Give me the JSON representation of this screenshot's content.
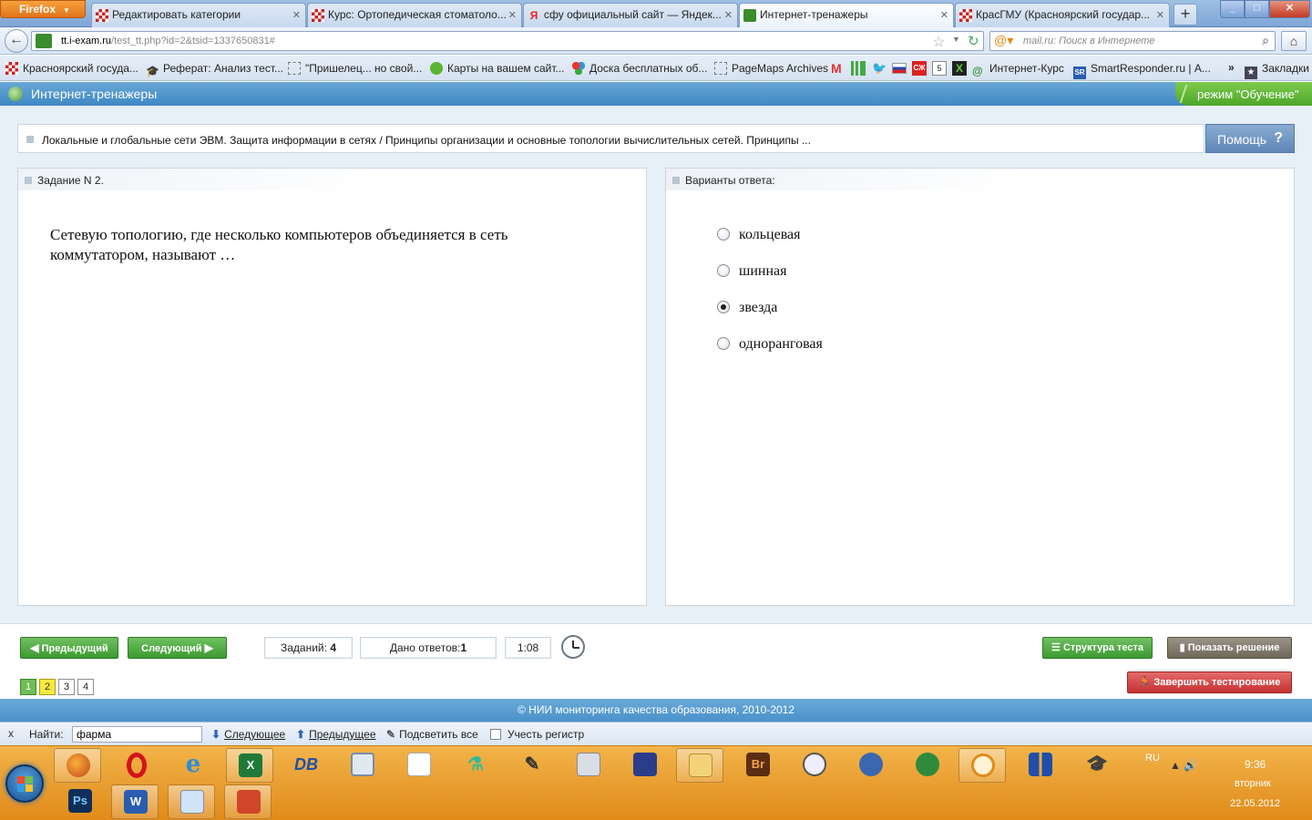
{
  "browser": {
    "menu_label": "Firefox",
    "tabs": [
      {
        "title": "Редактировать категории"
      },
      {
        "title": "Курс: Ортопедическая стоматоло..."
      },
      {
        "title": "сфу официальный сайт — Яндек..."
      },
      {
        "title": "Интернет-тренажеры"
      },
      {
        "title": "КрасГМУ (Красноярский государ..."
      }
    ],
    "new_tab": "+",
    "url_host": "tt.i-exam.ru",
    "url_path": "/test_tt.php?id=2&tsid=1337650831#",
    "search_placeholder": "mail.ru: Поиск в Интернете"
  },
  "bookmarks": [
    {
      "label": "Красноярский госуда..."
    },
    {
      "label": "Реферат: Анализ тест..."
    },
    {
      "label": "\"Пришелец... но свой..."
    },
    {
      "label": "Карты на вашем сайт..."
    },
    {
      "label": "Доска бесплатных об..."
    },
    {
      "label": "PageMaps Archives"
    },
    {
      "label": "Интернет-Курс"
    },
    {
      "label": "SmartResponder.ru | А..."
    },
    {
      "label": "Закладки"
    }
  ],
  "app": {
    "name": "Интернет-тренажеры",
    "mode": "режим \"Обучение\"",
    "topic": "Локальные и глобальные сети ЭВМ. Защита информации в сетях / Принципы организации и основные топологии вычислительных сетей. Принципы ...",
    "help_label": "Помощь",
    "help_symbol": "?"
  },
  "question": {
    "header": "Задание N 2.",
    "text": "Сетевую топологию, где несколько компьютеров объединяется в сеть коммутатором, называют …"
  },
  "answers": {
    "header": "Варианты ответа:",
    "options": [
      {
        "label": "кольцевая",
        "selected": false
      },
      {
        "label": "шинная",
        "selected": false
      },
      {
        "label": "звезда",
        "selected": true
      },
      {
        "label": "одноранговая",
        "selected": false
      }
    ]
  },
  "controls": {
    "prev_label": "Предыдущий",
    "next_label": "Следующий",
    "tasks_label": "Заданий:",
    "tasks_count": "4",
    "answered_label": "Дано ответов:",
    "answered_count": "1",
    "timer": "1:08",
    "structure_label": "Структура теста",
    "solution_label": "Показать решение",
    "finish_label": "Завершить тестирование",
    "pages": [
      {
        "num": "1",
        "state": "done"
      },
      {
        "num": "2",
        "state": "current"
      },
      {
        "num": "3",
        "state": "empty"
      },
      {
        "num": "4",
        "state": "empty"
      }
    ]
  },
  "footer": {
    "text": "© НИИ мониторинга качества образования, 2010-2012"
  },
  "findbar": {
    "close": "x",
    "label": "Найти:",
    "value": "фарма",
    "next_label": "Следующее",
    "prev_label": "Предыдущее",
    "highlight_label": "Подсветить все",
    "case_label": "Учесть регистр"
  },
  "taskbar": {
    "lang": "RU",
    "time": "9:36",
    "day": "вторник",
    "date": "22.05.2012"
  },
  "colors": {
    "header_blue": "#4a91cb",
    "mode_green": "#4ea62a",
    "nav_green": "#3d9a31",
    "finish_red": "#c53131",
    "taskbar_orange": "#e08b1a"
  }
}
